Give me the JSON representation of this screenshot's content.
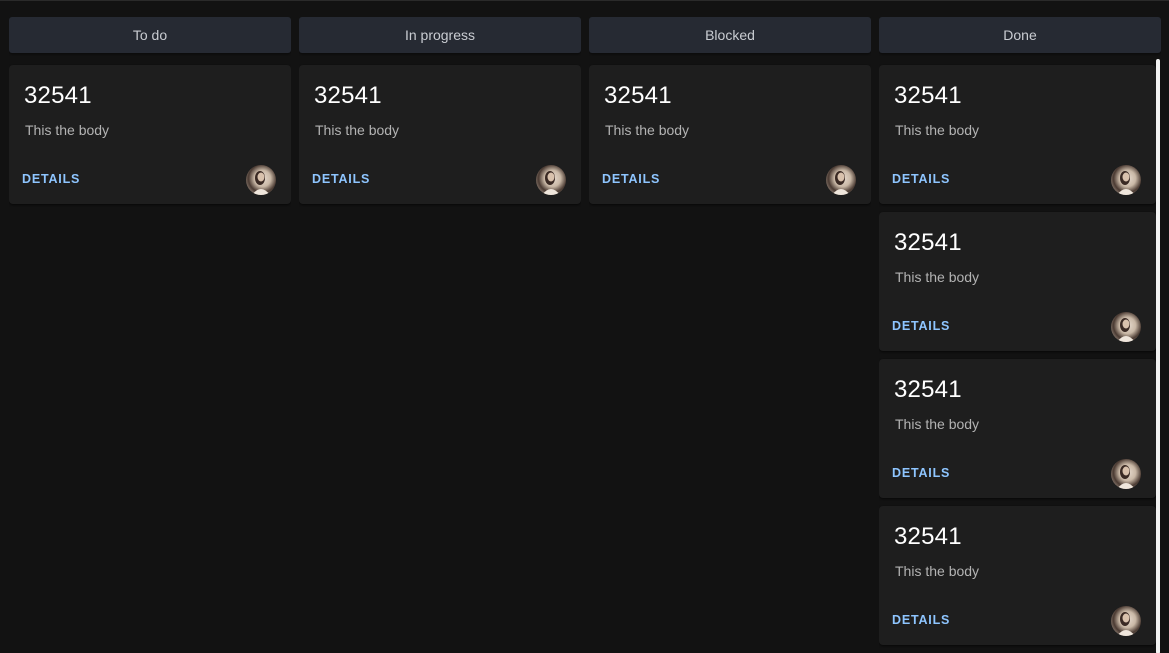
{
  "columns": [
    {
      "title": "To do",
      "cards": [
        {
          "id": "32541",
          "body": "This the body",
          "action": "DETAILS",
          "avatar": "user-avatar"
        }
      ]
    },
    {
      "title": "In progress",
      "cards": [
        {
          "id": "32541",
          "body": "This the body",
          "action": "DETAILS",
          "avatar": "user-avatar"
        }
      ]
    },
    {
      "title": "Blocked",
      "cards": [
        {
          "id": "32541",
          "body": "This the body",
          "action": "DETAILS",
          "avatar": "user-avatar"
        }
      ]
    },
    {
      "title": "Done",
      "cards": [
        {
          "id": "32541",
          "body": "This the body",
          "action": "DETAILS",
          "avatar": "user-avatar"
        },
        {
          "id": "32541",
          "body": "This the body",
          "action": "DETAILS",
          "avatar": "user-avatar"
        },
        {
          "id": "32541",
          "body": "This the body",
          "action": "DETAILS",
          "avatar": "user-avatar"
        },
        {
          "id": "32541",
          "body": "This the body",
          "action": "DETAILS",
          "avatar": "user-avatar"
        }
      ]
    }
  ],
  "colors": {
    "background": "#121212",
    "header": "#262a33",
    "card": "#1e1e1e",
    "link": "#8ec5ff"
  }
}
